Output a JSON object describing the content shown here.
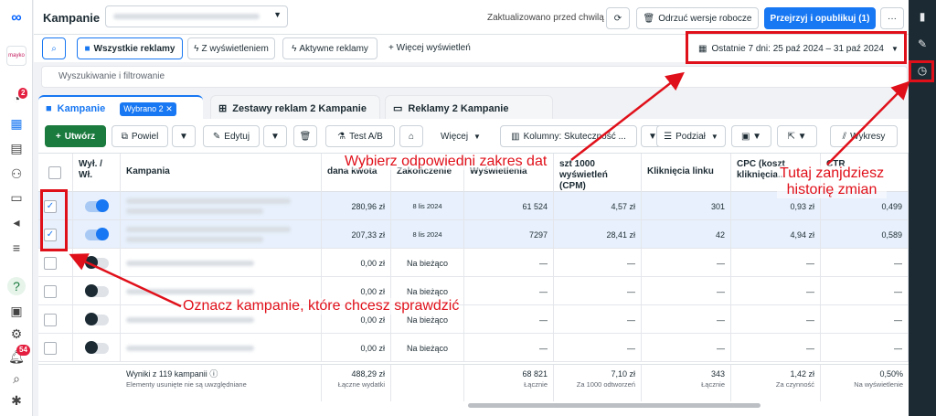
{
  "leftnav": {
    "logo": "meta-logo",
    "brand": "mayko",
    "notification_badge": "2",
    "bell_badge": "54"
  },
  "topbar": {
    "title": "Kampanie",
    "updated_text": "Zaktualizowano przed chwilą",
    "discard_label": "Odrzuć wersje robocze",
    "publish_label": "Przejrzyj i opublikuj (1)",
    "more_label": "···"
  },
  "filterbar": {
    "all_ads": "Wszystkie reklamy",
    "with_impressions": "Z wyświetleniem",
    "active_ads": "Aktywne reklamy",
    "more_views": "Więcej wyświetleń",
    "date_range": "Ostatnie 7 dni: 25 paź 2024 – 31 paź 2024"
  },
  "search": {
    "placeholder": "Wyszukiwanie i filtrowanie"
  },
  "tabs": {
    "campaigns": "Kampanie",
    "selected_chip": "Wybrano 2",
    "adsets": "Zestawy reklam 2 Kampanie",
    "ads": "Reklamy 2 Kampanie"
  },
  "toolbar": {
    "create": "Utwórz",
    "duplicate": "Powiel",
    "edit": "Edytuj",
    "ab_test": "Test A/B",
    "more": "Więcej",
    "columns": "Kolumny: Skuteczność ...",
    "breakdown": "Podział",
    "charts": "Wykresy"
  },
  "columns": {
    "onoff": "Wył. / Wł.",
    "campaign": "Kampania",
    "budget": "dana kwota",
    "end": "Zakończenie",
    "impressions": "Wyświetlenia",
    "cpm": "szt 1000 wyświetleń (CPM)",
    "clicks": "Kliknięcia linku",
    "cpc": "CPC (koszt kliknięcia...",
    "ctr": "CTR"
  },
  "rows": [
    {
      "checked": "✓",
      "on": true,
      "spent": "280,96 zł",
      "end": "8 lis 2024",
      "impressions": "61 524",
      "cpm": "4,57 zł",
      "clicks": "301",
      "cpc": "0,93 zł",
      "ctr": "0,499"
    },
    {
      "checked": "✓",
      "on": true,
      "spent": "207,33 zł",
      "end": "8 lis 2024",
      "impressions": "7297",
      "cpm": "28,41 zł",
      "clicks": "42",
      "cpc": "4,94 zł",
      "ctr": "0,589"
    },
    {
      "checked": "",
      "on": false,
      "spent": "0,00 zł",
      "end": "Na bieżąco",
      "impressions": "—",
      "cpm": "—",
      "clicks": "—",
      "cpc": "—",
      "ctr": "—"
    },
    {
      "checked": "",
      "on": false,
      "spent": "0,00 zł",
      "end": "Na bieżąco",
      "impressions": "—",
      "cpm": "—",
      "clicks": "—",
      "cpc": "—",
      "ctr": "—"
    },
    {
      "checked": "",
      "on": false,
      "spent": "0,00 zł",
      "end": "Na bieżąco",
      "impressions": "—",
      "cpm": "—",
      "clicks": "—",
      "cpc": "—",
      "ctr": "—"
    },
    {
      "checked": "",
      "on": false,
      "spent": "0,00 zł",
      "end": "Na bieżąco",
      "impressions": "—",
      "cpm": "—",
      "clicks": "—",
      "cpc": "—",
      "ctr": "—"
    }
  ],
  "footer": {
    "results": "Wyniki z 119 kampanii",
    "results_note": "Elementy usunięte nie są uwzględniane",
    "spent": "488,29 zł",
    "spent_note": "Łączne wydatki",
    "impressions": "68 821",
    "impressions_note": "Łącznie",
    "cpm": "7,10 zł",
    "cpm_note": "Za 1000 odtworzeń",
    "clicks": "343",
    "clicks_note": "Łącznie",
    "cpc": "1,42 zł",
    "cpc_note": "Za czynność",
    "ctr": "0,50%",
    "ctr_note": "Na wyświetlenie"
  },
  "annotations": {
    "date": "Wybierz odpowiedni zakres dat",
    "history": "Tutaj zanjdziesz historię zmian",
    "check": "Oznacz kampanie, które chcesz sprawdzić",
    "color": "#e0101a"
  }
}
